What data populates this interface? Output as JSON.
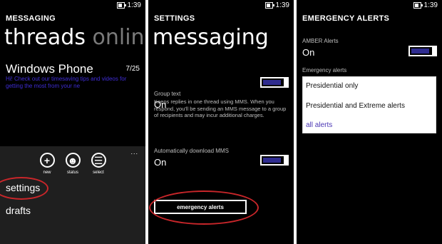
{
  "status_bar": {
    "time": "1:39"
  },
  "panel1": {
    "app_title": "MESSAGING",
    "pivot": {
      "active": "threads",
      "inactive": "online"
    },
    "thread": {
      "name": "Windows Phone",
      "date": "7/25",
      "preview": "Hi! Check out our timesaving tips and videos for getting the most from your ne"
    },
    "app_bar": {
      "more": "...",
      "buttons": [
        {
          "label": "new",
          "icon": "plus-icon",
          "glyph": "+"
        },
        {
          "label": "status",
          "icon": "person-icon",
          "glyph": "☻"
        },
        {
          "label": "select",
          "icon": "list-icon",
          "glyph": "☰"
        }
      ],
      "menu": [
        "settings",
        "drafts"
      ]
    }
  },
  "panel2": {
    "app_title": "SETTINGS",
    "page_title": "messaging",
    "group_text": {
      "label": "Group text",
      "value": "On",
      "description": "Keeps replies in one thread using MMS. When you respond, you'll be sending an MMS message to a group of recipients and may incur additional charges."
    },
    "auto_mms": {
      "label": "Automatically download MMS",
      "value": "On"
    },
    "emergency_button": "emergency alerts"
  },
  "panel3": {
    "app_title": "EMERGENCY ALERTS",
    "amber": {
      "label": "AMBER Alerts",
      "value": "On"
    },
    "emergency": {
      "label": "Emergency alerts",
      "options": [
        "Presidential only",
        "Presidential and Extreme alerts",
        "all alerts"
      ],
      "selected": "all alerts"
    }
  },
  "colors": {
    "background": "#000000",
    "app_bar": "#1f1f1f",
    "accent": "#2f2c8f",
    "link_text": "#3f2dd6",
    "annotation_red": "#c8262a"
  }
}
